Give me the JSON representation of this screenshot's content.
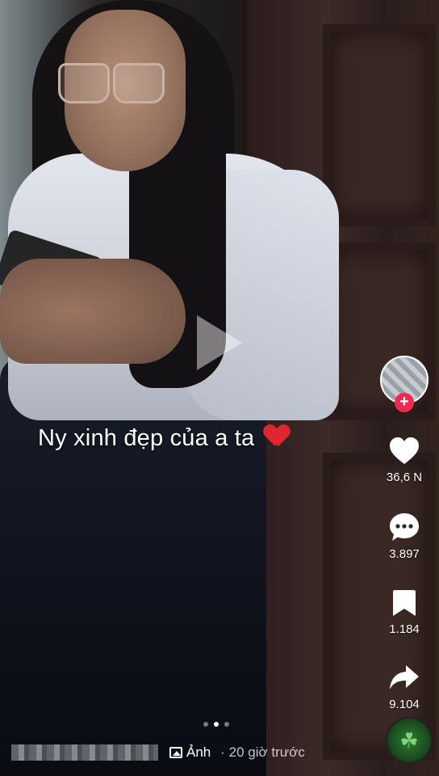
{
  "post": {
    "caption": "Ny xinh đẹp của a ta",
    "caption_emoji": "red-heart",
    "time_label": "· 20 giờ trước",
    "type_label": "Ảnh",
    "carousel": {
      "total": 3,
      "active_index": 2
    }
  },
  "actions": {
    "likes": "36,6 N",
    "comments": "3.897",
    "saves": "1.184",
    "shares": "9.104"
  },
  "icons": {
    "follow": "+",
    "music_disc": "☘"
  },
  "colors": {
    "follow_accent": "#f0294f",
    "heart_emoji": "#e0262e",
    "text": "#ffffff"
  }
}
